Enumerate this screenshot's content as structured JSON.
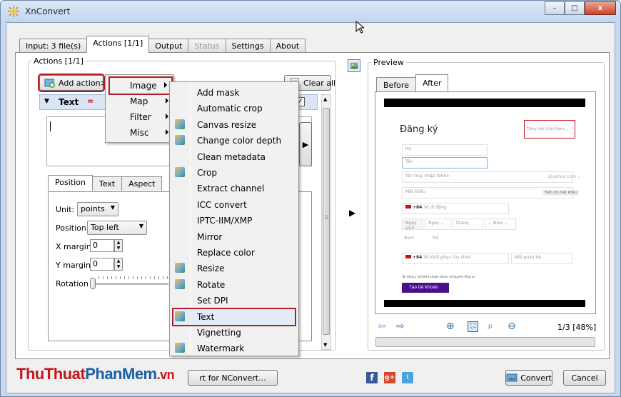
{
  "window": {
    "title": "XnConvert",
    "min": "–",
    "max": "□",
    "close": "x"
  },
  "tabs": [
    {
      "label": "Input: 3 file(s)"
    },
    {
      "label": "Actions [1/1]"
    },
    {
      "label": "Output"
    },
    {
      "label": "Status"
    },
    {
      "label": "Settings"
    },
    {
      "label": "About"
    }
  ],
  "actions": {
    "group_title": "Actions [1/1]",
    "add_action": "Add action>",
    "clear_all": "Clear all",
    "text_panel_label": "Text",
    "checkbox_mark": "✓",
    "subtabs": [
      "Position",
      "Text",
      "Aspect"
    ],
    "unit_label": "Unit:",
    "unit_value": "points",
    "position_label": "Position",
    "position_value": "Top left",
    "xmargin_label": "X margin",
    "xmargin_value": "0",
    "ymargin_label": "Y margin",
    "ymargin_value": "0",
    "rotation_label": "Rotation"
  },
  "menu_level1": [
    "Image",
    "Map",
    "Filter",
    "Misc"
  ],
  "menu_level2": [
    "Add mask",
    "Automatic crop",
    "Canvas resize",
    "Change color depth",
    "Clean metadata",
    "Crop",
    "Extract channel",
    "ICC convert",
    "IPTC-IIM/XMP",
    "Mirror",
    "Replace color",
    "Resize",
    "Rotate",
    "Set DPI",
    "Text",
    "Vignetting",
    "Watermark"
  ],
  "preview": {
    "group_title": "Preview",
    "tabs": [
      "Before",
      "After"
    ],
    "page_indicator": "1/3 [48%]",
    "signup": {
      "heading": "Đăng ký",
      "lang": "Tiếng Việt (Việt Nam) ⌄",
      "ho": "Họ",
      "ten": "Tên",
      "yahoo_name": "Tên truy nhập Yahoo",
      "yahoo_domain": "@yahoo.com ⌄",
      "password": "Mật khẩu",
      "show_password": "Hiển thị mật khẩu",
      "phone_code": "+84",
      "phone": "Số di động",
      "birth": "Ngày sinh",
      "day": "Ngày ⌄",
      "month": "Tháng",
      "year": "⌄ Năm ⌄",
      "male": "Nam",
      "female": "Nữ",
      "recovery_code": "+84",
      "recovery": "Số khôi phục tùy chọn",
      "relation": "Mối quan hệ",
      "terms": "Tôi đồng ý với Điều khoản Yahoo và Quyền riêng tư",
      "submit": "Tạo tài khoản"
    }
  },
  "bottom": {
    "logo_part1": "ThuThuat",
    "logo_part2": "PhanMem",
    "logo_part3": ".vn",
    "export_button": "rt for NConvert...",
    "convert": "Convert",
    "cancel": "Cancel"
  },
  "colors": {
    "highlight": "#b01e2a",
    "submit_bg": "#4a0e8f",
    "logo_red": "#c4161c",
    "logo_blue": "#1b5fa8"
  }
}
